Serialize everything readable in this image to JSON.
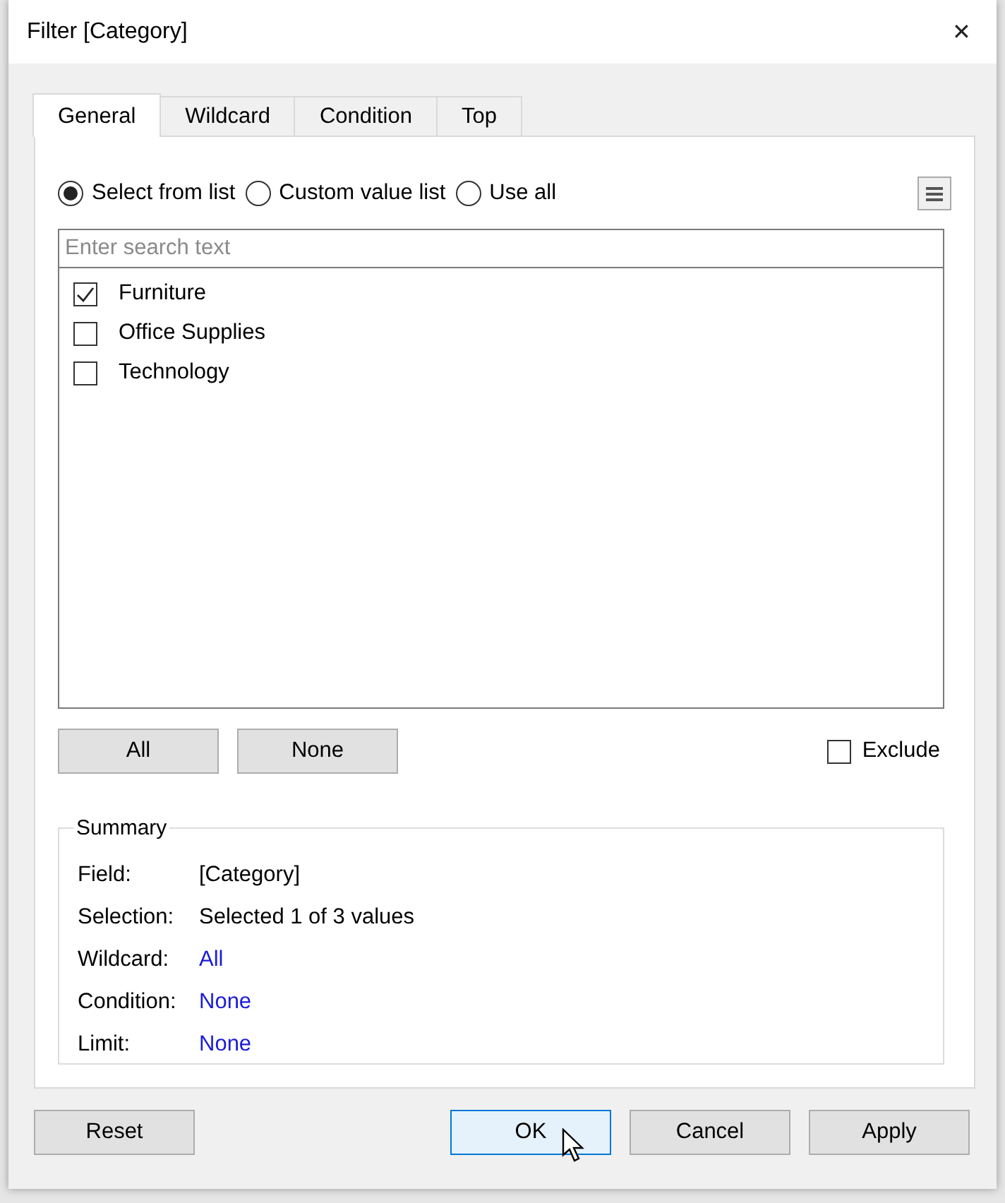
{
  "window": {
    "title": "Filter [Category]",
    "close": "✕"
  },
  "tabs": [
    {
      "label": "General",
      "selected": true
    },
    {
      "label": "Wildcard",
      "selected": false
    },
    {
      "label": "Condition",
      "selected": false
    },
    {
      "label": "Top",
      "selected": false
    }
  ],
  "mode_options": [
    {
      "label": "Select from list",
      "selected": true
    },
    {
      "label": "Custom value list",
      "selected": false
    },
    {
      "label": "Use all",
      "selected": false
    }
  ],
  "search": {
    "placeholder": "Enter search text"
  },
  "values": [
    {
      "label": "Furniture",
      "checked": true
    },
    {
      "label": "Office Supplies",
      "checked": false
    },
    {
      "label": "Technology",
      "checked": false
    }
  ],
  "list_buttons": [
    "All",
    "None"
  ],
  "exclude": {
    "label": "Exclude",
    "checked": false
  },
  "summary": {
    "title": "Summary",
    "rows": [
      {
        "label": "Field:",
        "value": "[Category]",
        "kind": "text"
      },
      {
        "label": "Selection:",
        "value": "Selected 1 of 3 values",
        "kind": "text"
      },
      {
        "label": "Wildcard:",
        "value": "All",
        "kind": "link"
      },
      {
        "label": "Condition:",
        "value": "None",
        "kind": "link"
      },
      {
        "label": "Limit:",
        "value": "None",
        "kind": "link"
      }
    ]
  },
  "reset_button": "Reset",
  "footer_buttons": [
    {
      "label": "OK",
      "focused": true
    },
    {
      "label": "Cancel",
      "focused": false
    },
    {
      "label": "Apply",
      "focused": false
    }
  ]
}
